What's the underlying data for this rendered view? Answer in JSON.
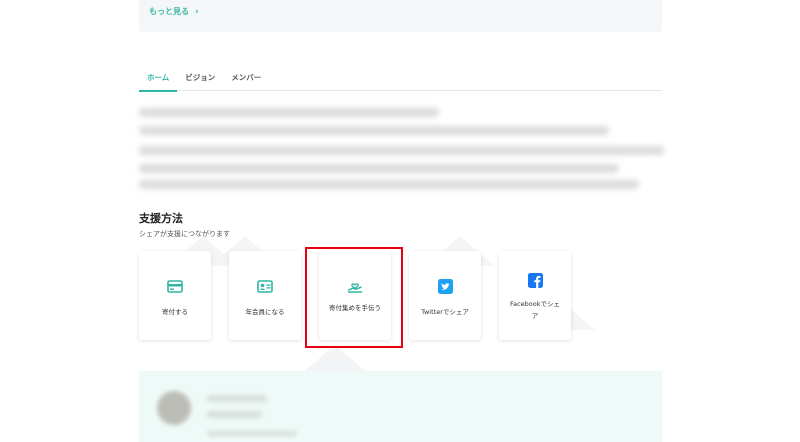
{
  "more": {
    "label": "もっと見る",
    "chevron": "›"
  },
  "tabs": [
    {
      "label": "ホーム",
      "active": true
    },
    {
      "label": "ビジョン",
      "active": false
    },
    {
      "label": "メンバー",
      "active": false
    }
  ],
  "support": {
    "title": "支援方法",
    "subtitle": "シェアが支援につながります",
    "cards": [
      {
        "label": "寄付する",
        "icon": "credit-card-icon"
      },
      {
        "label": "年会員になる",
        "icon": "member-card-icon"
      },
      {
        "label": "寄付集めを手伝う",
        "icon": "hand-heart-icon",
        "highlighted": true
      },
      {
        "label": "Twitterでシェア",
        "icon": "twitter-icon"
      },
      {
        "label": "Facebookでシェア",
        "icon": "facebook-icon"
      }
    ]
  },
  "colors": {
    "accent": "#2fb5a3",
    "highlight": "#e60012",
    "twitter": "#1da1f2",
    "facebook": "#1877f2"
  }
}
